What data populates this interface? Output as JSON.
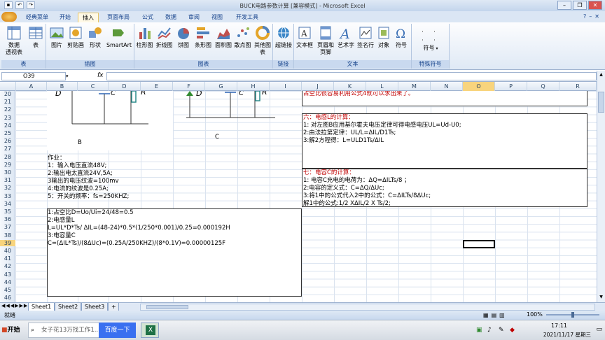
{
  "window": {
    "title": "BUCK电路参数计算  [兼容模式] - Microsoft Excel"
  },
  "menu": {
    "tabs": [
      "经典菜单",
      "开始",
      "插入",
      "页面布局",
      "公式",
      "数据",
      "审阅",
      "视图",
      "开发工具"
    ],
    "active_tab": "插入"
  },
  "ribbon": {
    "groups": [
      {
        "title": "表",
        "buttons": [
          "数据\n透视表",
          "表"
        ]
      },
      {
        "title": "插图",
        "buttons": [
          "图片",
          "剪贴画",
          "形状",
          "SmartArt"
        ]
      },
      {
        "title": "图表",
        "buttons": [
          "柱形图",
          "折线图",
          "饼图",
          "条形图",
          "面积图",
          "散点图",
          "其他图表"
        ]
      },
      {
        "title": "链接",
        "buttons": [
          "超链接"
        ]
      },
      {
        "title": "文本",
        "buttons": [
          "文本框",
          "页眉和\n页脚",
          "艺术字",
          "签名行",
          "对象",
          "符号"
        ]
      },
      {
        "title": "特殊符号",
        "buttons": [
          "符号"
        ]
      }
    ]
  },
  "formula_bar": {
    "name_box": "O39",
    "fx": "fx",
    "content": ""
  },
  "columns": [
    "A",
    "B",
    "C",
    "D",
    "E",
    "F",
    "G",
    "H",
    "I",
    "J",
    "K",
    "L",
    "M",
    "N",
    "O",
    "P",
    "Q",
    "R"
  ],
  "selected_column": "O",
  "rows": [
    "20",
    "21",
    "22",
    "23",
    "24",
    "25",
    "26",
    "27",
    "28",
    "29",
    "30",
    "31",
    "32",
    "33",
    "34",
    "35",
    "36",
    "37",
    "38",
    "39",
    "40",
    "41",
    "42",
    "43",
    "44",
    "45",
    "46"
  ],
  "selected_row": "39",
  "sheet": {
    "diagram_labels": {
      "d_left": "D",
      "c_left": "C",
      "r_left": "R",
      "d_right": "D",
      "c_right": "C",
      "r_right": "R",
      "b_label": "B",
      "c_label": "C"
    },
    "homework": [
      "作业：",
      "1：输入电压直流48V;",
      "2:输出电太直流24V,5A;",
      "3输出的电压纹波=100mv",
      "4:电流的纹波是0.25A;",
      "5：开关的频率：fs=250KHZ;"
    ],
    "answers": [
      "1:占空比D=Uo/Ui=24/48=0.5",
      "2:电感量L",
      "L=UL*D*Ts/ ΔIL=(48-24)*0.5*(1/250*0.001)/0.25=0.000192H",
      "3:电容量C",
      "C=(ΔIL*Ts)/(8ΔUc)=(0.25A/250KHZ)/(8*0.1V)=0.00000125F"
    ],
    "top_note": "占空比很容易利用公式4就可以求出来了。",
    "section6": {
      "title": "六：电感L的计算：",
      "lines": [
        "1: 对左图B应用基尔霍夫电压定律可得电感电压UL=Ud-U0;",
        "2:由法拉第定律：UL/L=ΔIL/D1Ts;",
        "3:解2方程得：L=ULD1Ts/ΔIL"
      ]
    },
    "section7": {
      "title": "七：电容C的计算：",
      "lines": [
        "1: 电容C充电的电荷为：ΔQ=ΔILTs/8  ；",
        "2:电容的定义式：C=ΔQ/ΔUc;",
        "3:将1中的公式代入2中的公式：C=ΔILTs/8ΔUc;",
        "解1中的公式:1/2 XΔIL/2 X Ts/2;"
      ]
    }
  },
  "sheet_tabs": [
    "Sheet1",
    "Sheet2",
    "Sheet3"
  ],
  "active_sheet": "Sheet1",
  "status": {
    "left": "就绪",
    "zoom": "100%"
  },
  "taskbar": {
    "start": "开始",
    "search_text": "女子花13万找工作1...",
    "search_button": "百度一下",
    "time": "17:11",
    "date": "2021/11/17 星期三"
  }
}
